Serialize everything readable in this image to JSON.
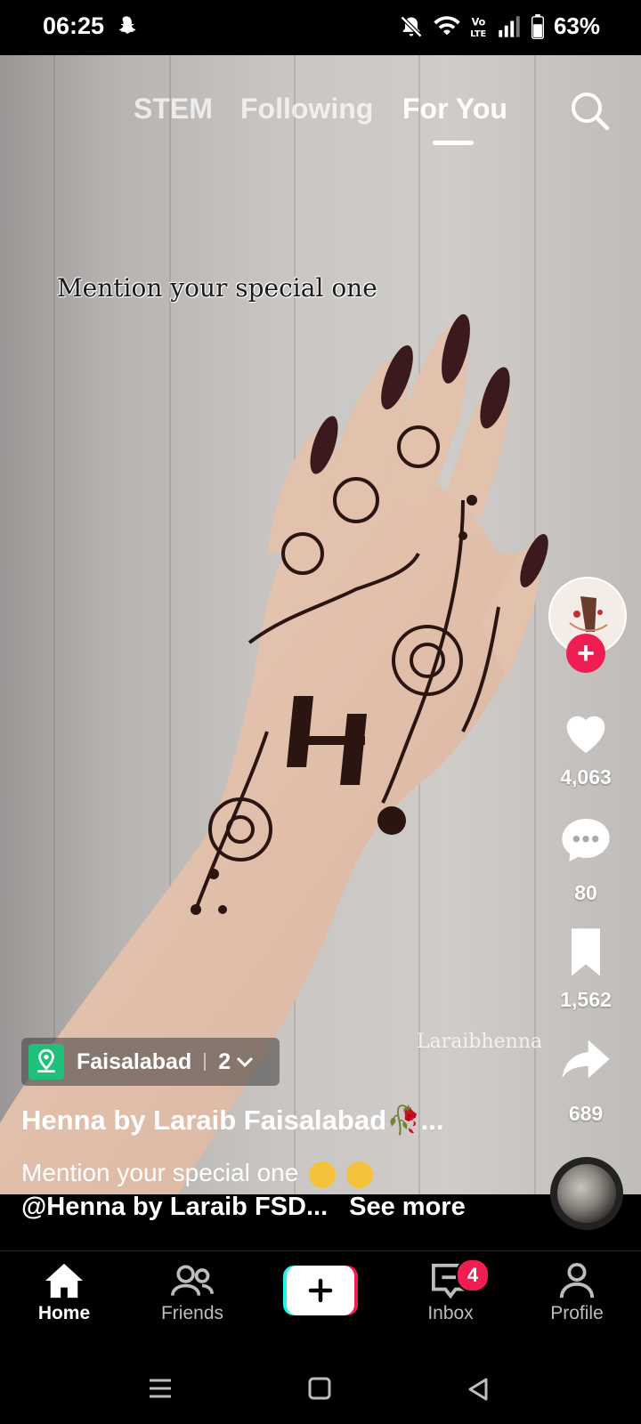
{
  "status_bar": {
    "time": "06:25",
    "battery": "63%"
  },
  "top_tabs": [
    {
      "label": "STEM",
      "active": false
    },
    {
      "label": "Following",
      "active": false
    },
    {
      "label": "For You",
      "active": true
    }
  ],
  "video": {
    "overlay_text": "Mention your special one",
    "watermark": "Laraibhenna"
  },
  "actions": {
    "likes": "4,063",
    "comments": "80",
    "saves": "1,562",
    "shares": "689"
  },
  "location": {
    "name": "Faisalabad",
    "count": "2"
  },
  "post": {
    "creator": "Henna by Laraib Faisalabad🥀...",
    "caption": "Mention your special one",
    "mention": "@Henna by Laraib FSD...",
    "see_more": "See more"
  },
  "bottom_nav": {
    "home": "Home",
    "friends": "Friends",
    "inbox": "Inbox",
    "inbox_badge": "4",
    "profile": "Profile"
  },
  "colors": {
    "accent": "#ee1d52",
    "location_icon": "#20c07a",
    "create_cyan": "#25f4ee"
  }
}
